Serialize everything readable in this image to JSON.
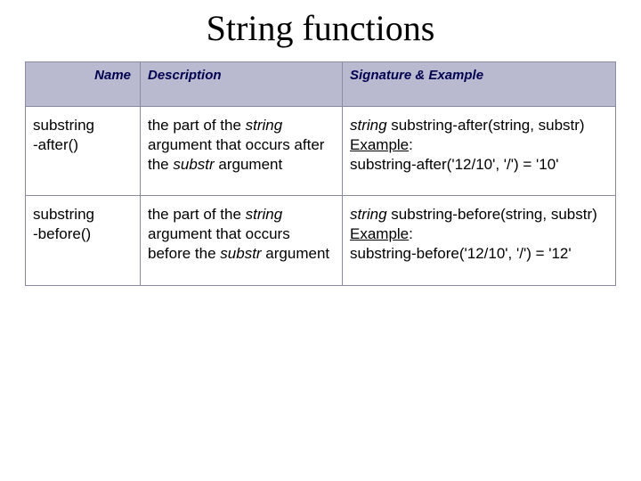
{
  "title": "String functions",
  "headers": {
    "name": "Name",
    "desc": "Description",
    "sig": "Signature & Example"
  },
  "rows": [
    {
      "name_l1": "substring",
      "name_l2": "-after()",
      "desc": {
        "p1": "the part of the ",
        "i1": "string",
        "p2": " argument that occurs after the ",
        "i2": "substr",
        "p3": " argument"
      },
      "sig": {
        "ret": "string",
        "call": " substring-after(string, substr)",
        "ex_label": "Example",
        "ex_colon": ":",
        "ex_body": "substring-after('12/10', '/') = '10'"
      }
    },
    {
      "name_l1": "substring",
      "name_l2": "-before()",
      "desc": {
        "p1": "the part of the ",
        "i1": "string",
        "p2": " argument that occurs before the ",
        "i2": "substr",
        "p3": " argument"
      },
      "sig": {
        "ret": "string",
        "call": " substring-before(string, substr)",
        "ex_label": "Example",
        "ex_colon": ":",
        "ex_body": "substring-before('12/10', '/') = '12'"
      }
    }
  ]
}
